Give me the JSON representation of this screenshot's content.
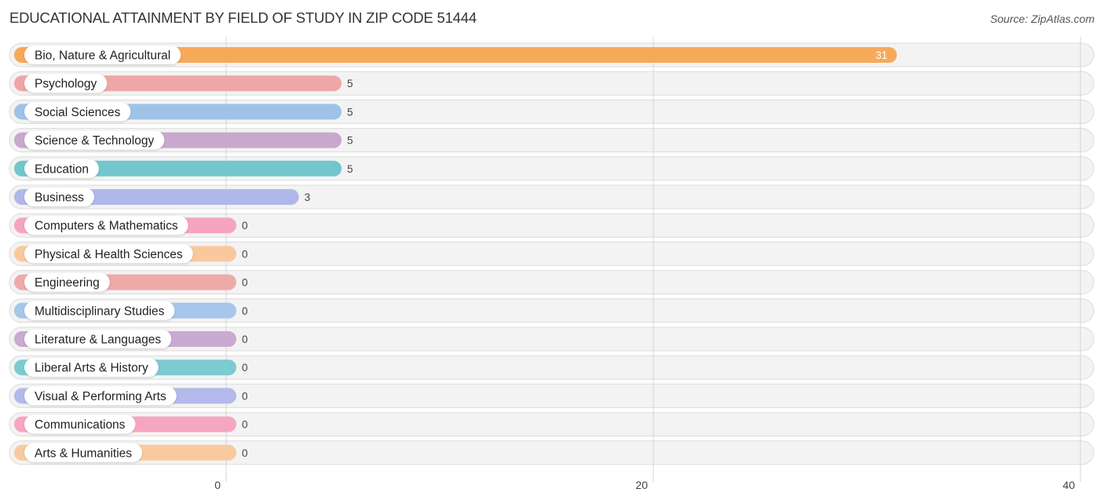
{
  "header": {
    "title": "EDUCATIONAL ATTAINMENT BY FIELD OF STUDY IN ZIP CODE 51444",
    "source": "Source: ZipAtlas.com"
  },
  "chart_data": {
    "type": "bar",
    "orientation": "horizontal",
    "title": "EDUCATIONAL ATTAINMENT BY FIELD OF STUDY IN ZIP CODE 51444",
    "xlabel": "",
    "ylabel": "",
    "xlim": [
      0,
      40
    ],
    "xticks": [
      0,
      20,
      40
    ],
    "grid": true,
    "categories": [
      "Bio, Nature & Agricultural",
      "Psychology",
      "Social Sciences",
      "Science & Technology",
      "Education",
      "Business",
      "Computers & Mathematics",
      "Physical & Health Sciences",
      "Engineering",
      "Multidisciplinary Studies",
      "Literature & Languages",
      "Liberal Arts & History",
      "Visual & Performing Arts",
      "Communications",
      "Arts & Humanities"
    ],
    "values": [
      31,
      5,
      5,
      5,
      5,
      3,
      0,
      0,
      0,
      0,
      0,
      0,
      0,
      0,
      0
    ],
    "colors": [
      "#f7a95a",
      "#eea7a6",
      "#9fc3e8",
      "#c9a8cd",
      "#72c6cc",
      "#b0b8ea",
      "#f5a5c0",
      "#f9c99d",
      "#eeaaa9",
      "#a6c7eb",
      "#c9aad0",
      "#7ccbd1",
      "#b3b9ea",
      "#f6a6c2",
      "#f9ca9f"
    ]
  }
}
